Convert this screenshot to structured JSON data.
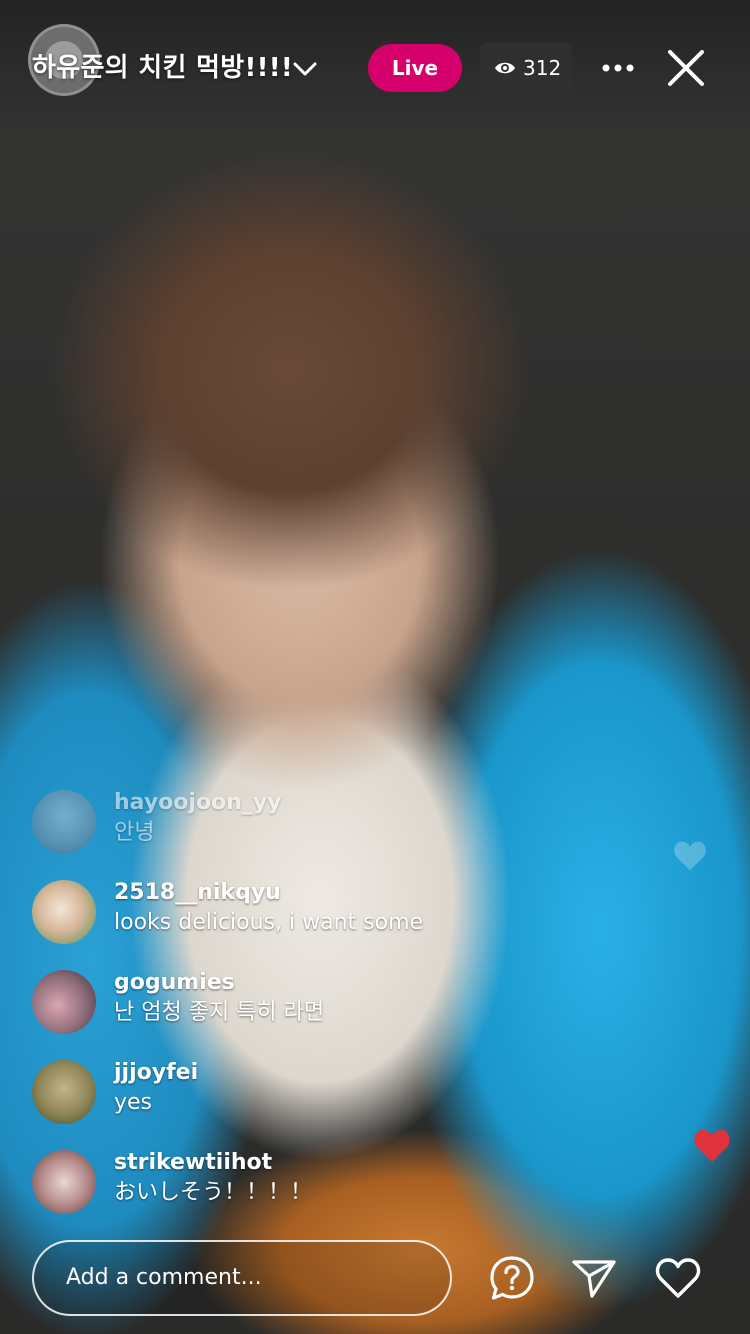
{
  "header": {
    "title": "하유준의 치킨 먹방!!!!",
    "live_label": "Live",
    "viewer_count": "312"
  },
  "comments": [
    {
      "username": "hayoojoon_yy",
      "text": "안녕"
    },
    {
      "username": "2518__nikqyu",
      "text": "looks delicious, i want some"
    },
    {
      "username": "gogumies",
      "text": "난 엄청 좋지 특히 라면"
    },
    {
      "username": "jjjoyfei",
      "text": "yes"
    },
    {
      "username": "strikewtiihot",
      "text": "おいしそう！！！！"
    }
  ],
  "composer": {
    "placeholder": "Add a comment..."
  },
  "colors": {
    "live_badge": "#d6006d",
    "heart": "#e0323c"
  },
  "icons": [
    "chevron-down-icon",
    "eye-icon",
    "more-icon",
    "close-icon",
    "question-icon",
    "send-icon",
    "heart-icon"
  ]
}
